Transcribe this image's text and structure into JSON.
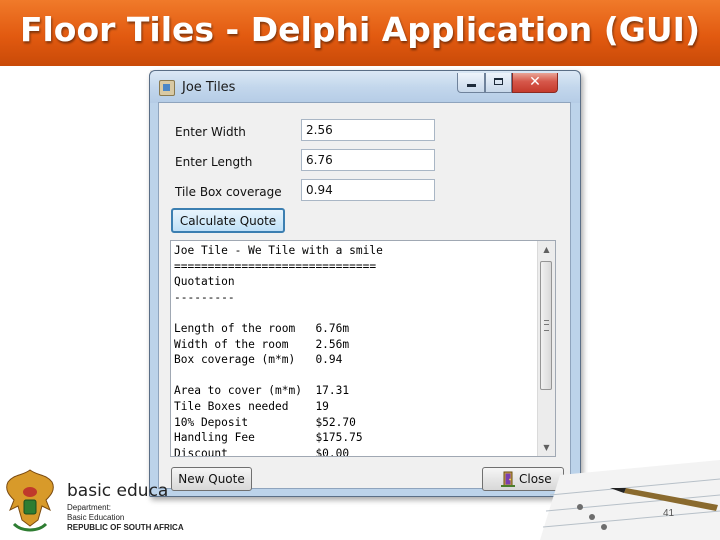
{
  "slide": {
    "title": "Floor Tiles - Delphi Application (GUI)",
    "page_number": "41"
  },
  "window": {
    "title": "Joe Tiles",
    "close_glyph": "✕"
  },
  "form": {
    "width_label": "Enter Width",
    "width_value": "2.56",
    "length_label": "Enter Length",
    "length_value": "6.76",
    "coverage_label": "Tile Box coverage",
    "coverage_value": "0.94",
    "calculate_button": "Calculate Quote",
    "new_quote_button": "New Quote",
    "close_button": "Close"
  },
  "memo": {
    "lines": [
      "Joe Tile - We Tile with a smile",
      "==============================",
      "Quotation",
      "---------",
      "",
      "Length of the room   6.76m",
      "Width of the room    2.56m",
      "Box coverage (m*m)   0.94",
      "",
      "Area to cover (m*m)  17.31",
      "Tile Boxes needed    19",
      "10% Deposit          $52.70",
      "Handling Fee         $175.75",
      "Discount             $0.00"
    ]
  },
  "footer": {
    "brand": "basic educa",
    "dept_line1": "Department:",
    "dept_line2": "Basic Education",
    "dept_line3": "REPUBLIC OF SOUTH AFRICA"
  },
  "icons": {
    "app": "tile-app-icon",
    "minimize": "minimize-icon",
    "maximize": "maximize-icon",
    "close": "close-icon",
    "close_door": "door-exit-icon"
  },
  "colors": {
    "header_orange": "#e25a10",
    "title_text": "#ffffff",
    "calc_button_border": "#3c7fb1"
  }
}
